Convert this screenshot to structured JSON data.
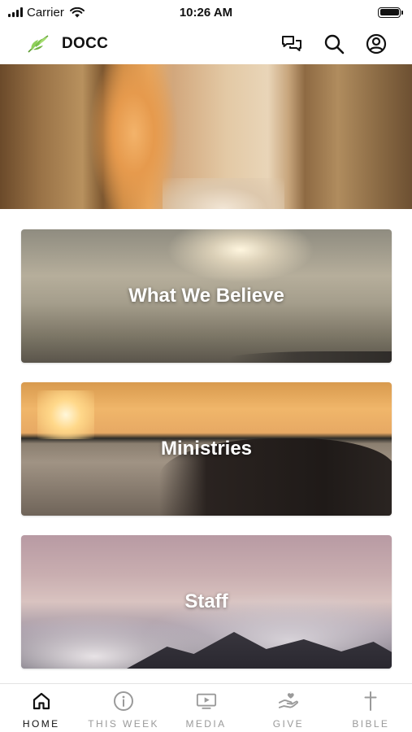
{
  "status_bar": {
    "carrier": "Carrier",
    "time": "10:26 AM",
    "icons": [
      "signal-icon",
      "wifi-icon",
      "battery-icon"
    ]
  },
  "header": {
    "title": "DOCC",
    "logo_icon": "leaf-logo",
    "actions": [
      {
        "name": "chat-icon"
      },
      {
        "name": "search-icon"
      },
      {
        "name": "profile-icon"
      }
    ]
  },
  "hero": {
    "image": "empty-tomb-photo"
  },
  "cards": [
    {
      "label": "What We Believe",
      "image": "clouds-sunburst-photo"
    },
    {
      "label": "Ministries",
      "image": "heart-hands-sunset-photo"
    },
    {
      "label": "Staff",
      "image": "mountains-clouds-photo"
    }
  ],
  "bottom_nav": {
    "items": [
      {
        "label": "HOME",
        "icon": "home-icon",
        "active": true
      },
      {
        "label": "THIS WEEK",
        "icon": "info-icon",
        "active": false
      },
      {
        "label": "MEDIA",
        "icon": "media-play-icon",
        "active": false
      },
      {
        "label": "GIVE",
        "icon": "give-hand-heart-icon",
        "active": false
      },
      {
        "label": "BIBLE",
        "icon": "cross-icon",
        "active": false
      }
    ]
  },
  "colors": {
    "active": "#111111",
    "inactive": "#9a9a9a",
    "logo_green": "#7cc24a"
  }
}
